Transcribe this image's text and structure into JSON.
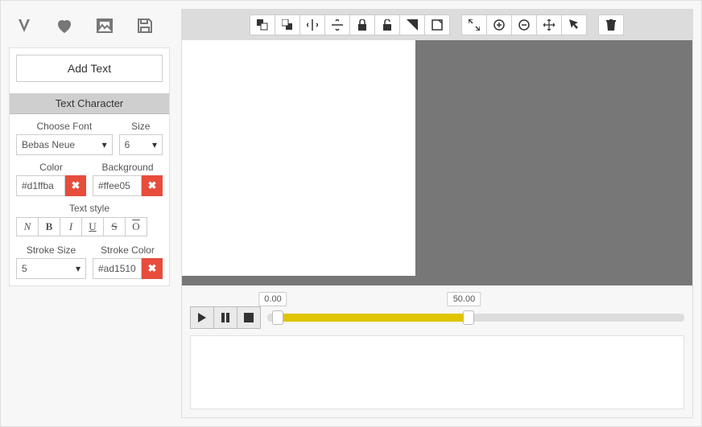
{
  "leftTabs": {
    "icons": [
      "text-tool-icon",
      "shape-heart-icon",
      "image-tool-icon",
      "save-icon"
    ]
  },
  "addTextBtn": "Add Text",
  "section": {
    "title": "Text Character",
    "fontLabel": "Choose Font",
    "fontValue": "Bebas Neue",
    "sizeLabel": "Size",
    "sizeValue": "6",
    "colorLabel": "Color",
    "colorValue": "#d1ffba",
    "bgLabel": "Background",
    "bgValue": "#ffee05",
    "styleLabel": "Text style",
    "styleButtons": {
      "normal": "N",
      "bold": "B",
      "italic": "I",
      "underline": "U",
      "strike": "S",
      "overline": "O"
    },
    "strokeSizeLabel": "Stroke Size",
    "strokeSizeValue": "5",
    "strokeColorLabel": "Stroke Color",
    "strokeColorValue": "#ad1510"
  },
  "timeline": {
    "start": "0.00",
    "current": "50.00"
  }
}
